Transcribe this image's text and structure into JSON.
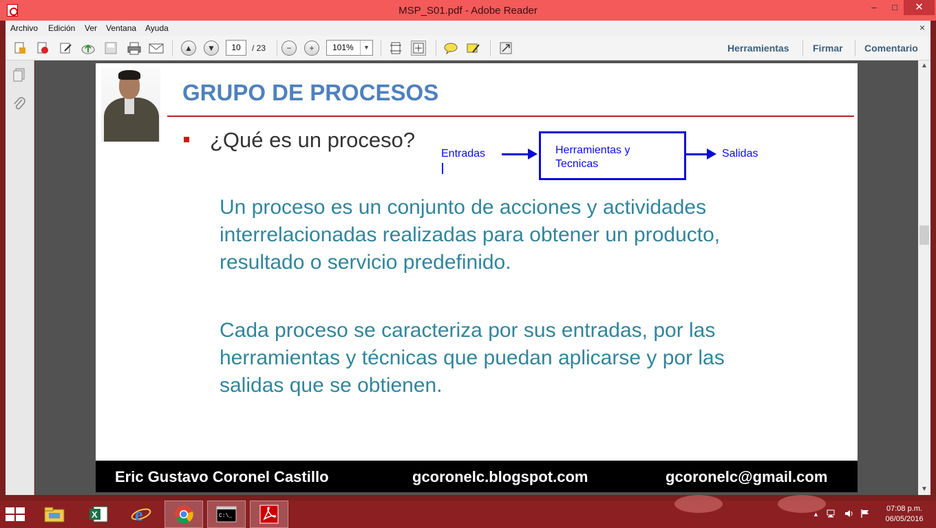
{
  "window": {
    "title": "MSP_S01.pdf - Adobe Reader",
    "min_glyph": "–",
    "max_glyph": "□",
    "close_glyph": "✕"
  },
  "menu": {
    "items": [
      "Archivo",
      "Edición",
      "Ver",
      "Ventana",
      "Ayuda"
    ],
    "close_glyph": "×"
  },
  "toolbar": {
    "page_current": "10",
    "page_total": "/ 23",
    "zoom": "101%",
    "links": [
      "Herramientas",
      "Firmar",
      "Comentario"
    ]
  },
  "slide": {
    "title": "GRUPO DE PROCESOS",
    "question": "¿Qué es un proceso?",
    "diagram": {
      "input": "Entradas",
      "process_line1": "Herramientas y",
      "process_line2": "Tecnicas",
      "output": "Salidas"
    },
    "para1": [
      "Un proceso es un conjunto de acciones y actividades",
      "interrelacionadas realizadas para obtener un producto,",
      "resultado o servicio predefinido."
    ],
    "para2": [
      "Cada proceso se caracteriza por sus entradas, por las",
      "herramientas y técnicas que puedan aplicarse y por las",
      "salidas que se obtienen."
    ],
    "footer": {
      "name": "Eric Gustavo Coronel Castillo",
      "blog": "gcoronelc.blogspot.com",
      "email": "gcoronelc@gmail.com"
    }
  },
  "taskbar": {
    "time": "07:08 p.m.",
    "date": "06/05/2016"
  },
  "colors": {
    "title_bar": "#f45a5a",
    "taskbar": "#8b1f22",
    "slide_title": "#4f81bd",
    "body_text": "#31859c",
    "diagram": "#0a0ad8"
  },
  "icons": [
    "acrobat-icon",
    "create-pdf-icon",
    "edit-icon",
    "cloud-upload-icon",
    "save-icon",
    "print-icon",
    "email-icon",
    "page-up-icon",
    "page-down-icon",
    "zoom-out-icon",
    "zoom-in-icon",
    "fit-page-icon",
    "fit-width-icon",
    "comment-icon",
    "highlight-icon",
    "fullscreen-icon",
    "pages-icon",
    "attachment-icon",
    "windows-start-icon",
    "file-explorer-icon",
    "excel-icon",
    "internet-explorer-icon",
    "chrome-icon",
    "cmd-icon",
    "adobe-reader-icon"
  ]
}
